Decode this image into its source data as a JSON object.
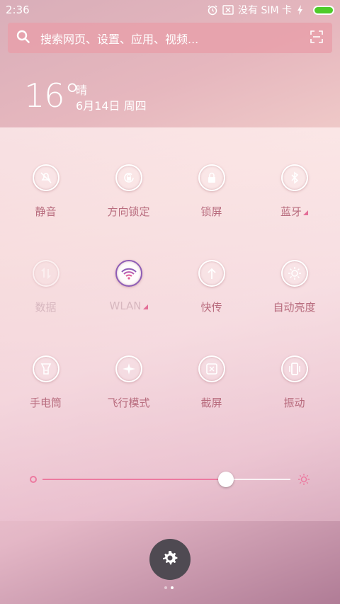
{
  "status_bar": {
    "time": "2:36",
    "carrier": "没有 SIM 卡",
    "icons": [
      "alarm-icon",
      "screenshot-cancel-icon",
      "charging-icon",
      "battery-icon"
    ]
  },
  "search": {
    "placeholder": "搜索网页、设置、应用、视频...",
    "icons": [
      "search-icon",
      "scan-icon"
    ]
  },
  "weather": {
    "temperature": "16°",
    "condition": "晴",
    "date": "6月14日 周四"
  },
  "toggles": [
    {
      "label": "静音",
      "icon": "mute-icon",
      "enabled": true
    },
    {
      "label": "方向锁定",
      "icon": "rotation-lock-icon",
      "enabled": true
    },
    {
      "label": "锁屏",
      "icon": "lock-icon",
      "enabled": true
    },
    {
      "label": "蓝牙",
      "icon": "bluetooth-icon",
      "enabled": true,
      "has_more": true
    },
    {
      "label": "数据",
      "icon": "data-icon",
      "enabled": false
    },
    {
      "label": "WLAN",
      "icon": "wifi-icon",
      "enabled": false,
      "has_more": true,
      "active": true
    },
    {
      "label": "快传",
      "icon": "quick-transfer-icon",
      "enabled": true
    },
    {
      "label": "自动亮度",
      "icon": "auto-brightness-icon",
      "enabled": true
    },
    {
      "label": "手电筒",
      "icon": "flashlight-icon",
      "enabled": true
    },
    {
      "label": "飞行模式",
      "icon": "airplane-icon",
      "enabled": true
    },
    {
      "label": "截屏",
      "icon": "screenshot-icon",
      "enabled": true
    },
    {
      "label": "振动",
      "icon": "vibrate-icon",
      "enabled": true
    }
  ],
  "brightness": {
    "level": 0.74
  },
  "pager": {
    "count": 2,
    "active_index": 1
  },
  "colors": {
    "accent": "#ec7aa0",
    "label": "#b86c7e",
    "battery": "#4ecb2a"
  }
}
